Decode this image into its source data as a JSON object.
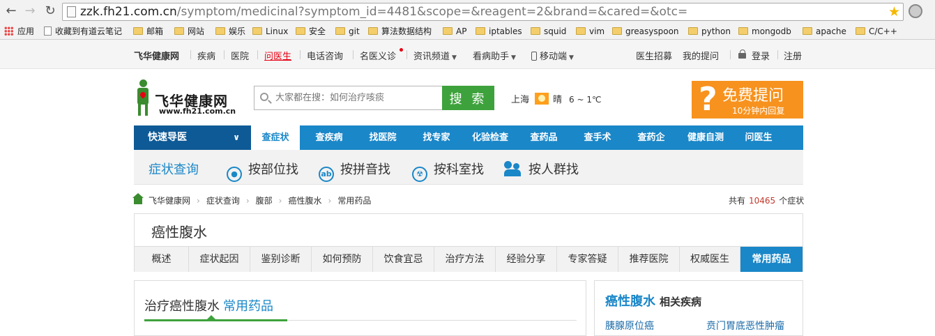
{
  "browser": {
    "url_host": "zzk.fh21.com.cn",
    "url_path": "/symptom/medicinal?symptom_id=4481&scope=&reagent=2&brand=&cared=&otc=",
    "bookmarks": [
      "应用",
      "收藏到有道云笔记",
      "邮箱",
      "网站",
      "娱乐",
      "Linux",
      "安全",
      "git",
      "算法数据结构",
      "AP",
      "iptables",
      "squid",
      "vim",
      "greasyspoon",
      "python",
      "mongodb",
      "apache",
      "C/C++"
    ]
  },
  "topbar": {
    "brand": "飞华健康网",
    "links": [
      "疾病",
      "医院",
      "问医生",
      "电话咨询",
      "名医义诊",
      "资讯频道",
      "看病助手",
      "移动端"
    ],
    "right": [
      "医生招募",
      "我的提问",
      "登录",
      "注册"
    ]
  },
  "logo": {
    "title": "飞华健康网",
    "url": "www.fh21.com.cn"
  },
  "search": {
    "placeholder": "大家都在搜：如何治疗咳痰",
    "button": "搜 索"
  },
  "weather": {
    "city": "上海",
    "condition": "晴",
    "temp": "6 ~ 1℃"
  },
  "ask": {
    "icon": "?",
    "title": "免费提问",
    "subtitle": "10分钟内回复"
  },
  "mainnav": {
    "quick": "快速导医",
    "items": [
      "查症状",
      "查疾病",
      "找医院",
      "找专家",
      "化验检查",
      "查药品",
      "查手术",
      "查药企",
      "健康自测",
      "问医生"
    ],
    "active_index": 0
  },
  "subnav": {
    "title": "症状查询",
    "items": [
      "按部位找",
      "按拼音找",
      "按科室找",
      "按人群找"
    ],
    "ab_glyph": "ab"
  },
  "breadcrumb": [
    "飞华健康网",
    "症状查询",
    "腹部",
    "癌性腹水",
    "常用药品"
  ],
  "count": {
    "prefix": "共有",
    "num": "10465",
    "suffix": "个症状"
  },
  "disease": {
    "title": "癌性腹水",
    "tabs": [
      "概述",
      "症状起因",
      "鉴别诊断",
      "如何预防",
      "饮食宜忌",
      "治疗方法",
      "经验分享",
      "专家答疑",
      "推荐医院",
      "权威医生",
      "常用药品"
    ],
    "active_tab": "常用药品"
  },
  "content": {
    "title_prefix": "治疗癌性腹水",
    "title_blue": "常用药品"
  },
  "side": {
    "title_blue": "癌性腹水",
    "title_rest": "相关疾病",
    "links": [
      "胰腺原位癌",
      "贲门胃底恶性肿瘤"
    ]
  },
  "colors": {
    "nav_blue": "#1a87c8",
    "nav_dark": "#0e5a96",
    "green": "#3ea23c",
    "orange": "#f7921e",
    "red": "#e60012"
  }
}
